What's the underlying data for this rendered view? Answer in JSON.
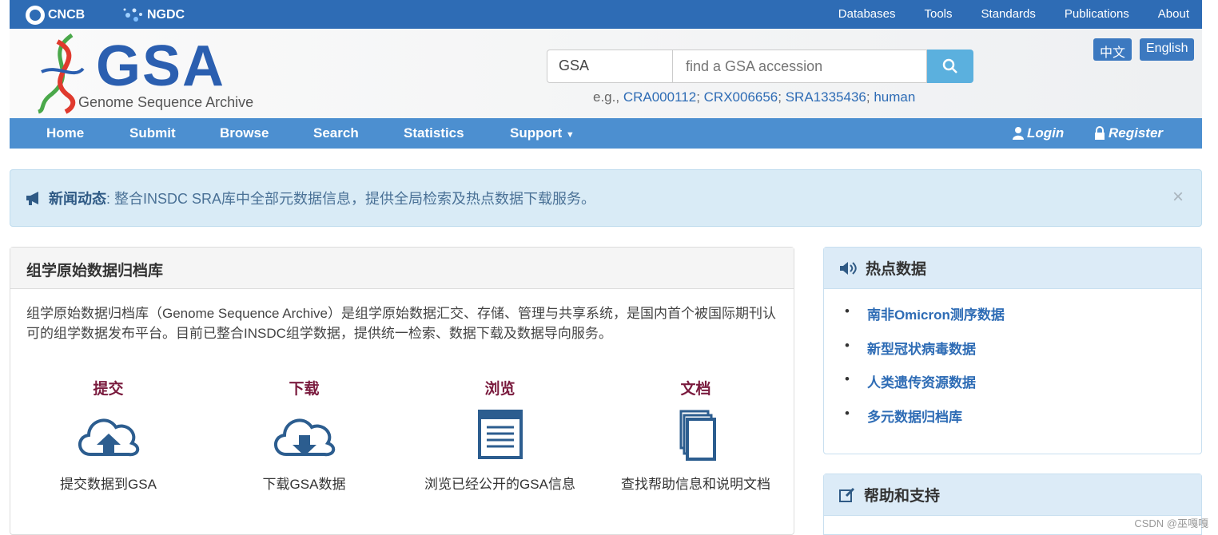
{
  "topbar": {
    "brand_cncb": "CNCB",
    "brand_ngdc": "NGDC",
    "nav": [
      "Databases",
      "Tools",
      "Standards",
      "Publications",
      "About"
    ]
  },
  "header": {
    "logo_text": "GSA",
    "logo_subtitle": "Genome Sequence Archive",
    "search_type": "GSA",
    "search_placeholder": "find a GSA accession",
    "examples_prefix": "e.g.,",
    "examples": [
      "CRA000112",
      "CRX006656",
      "SRA1335436",
      "human"
    ],
    "lang_zh": "中文",
    "lang_en": "English"
  },
  "mainnav": {
    "items": [
      "Home",
      "Submit",
      "Browse",
      "Search",
      "Statistics",
      "Support"
    ],
    "login": "Login",
    "register": "Register"
  },
  "alert": {
    "title": "新闻动态",
    "text": ": 整合INSDC SRA库中全部元数据信息，提供全局检索及热点数据下载服务。",
    "close": "×"
  },
  "left_panel": {
    "title": "组学原始数据归档库",
    "description": "组学原始数据归档库（Genome Sequence Archive）是组学原始数据汇交、存储、管理与共享系统，是国内首个被国际期刊认可的组学数据发布平台。目前已整合INSDC组学数据，提供统一检索、数据下载及数据导向服务。",
    "features": [
      {
        "title": "提交",
        "desc": "提交数据到GSA",
        "icon": "cloud-upload-icon"
      },
      {
        "title": "下载",
        "desc": "下载GSA数据",
        "icon": "cloud-download-icon"
      },
      {
        "title": "浏览",
        "desc": "浏览已经公开的GSA信息",
        "icon": "browser-window-icon"
      },
      {
        "title": "文档",
        "desc": "查找帮助信息和说明文档",
        "icon": "documents-icon"
      }
    ]
  },
  "hot_panel": {
    "title": "热点数据",
    "items": [
      "南非Omicron测序数据",
      "新型冠状病毒数据",
      "人类遗传资源数据",
      "多元数据归档库"
    ]
  },
  "help_panel": {
    "title": "帮助和支持"
  },
  "watermark": "CSDN @巫嘎嘎",
  "colors": {
    "topbar": "#2e6cb5",
    "mainnav": "#4c8fd0",
    "accent_title": "#7a1b3e",
    "link": "#2e6cb5"
  }
}
